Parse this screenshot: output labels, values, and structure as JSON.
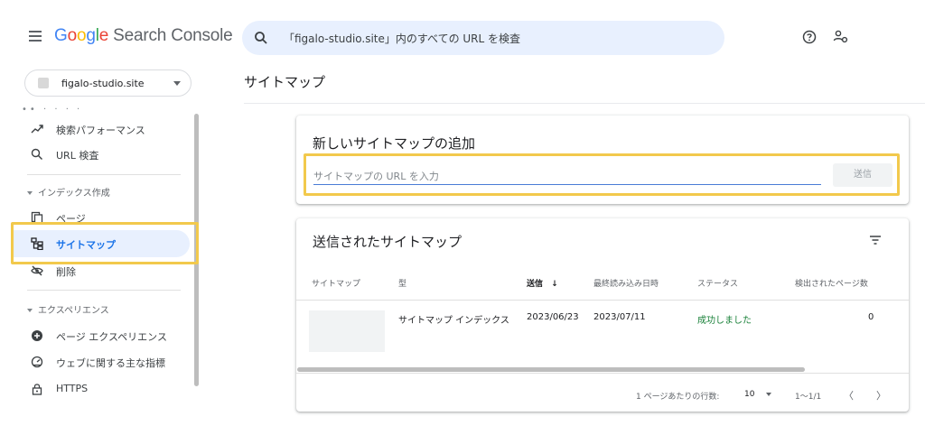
{
  "header": {
    "logo_parts": [
      "G",
      "o",
      "o",
      "g",
      "l",
      "e"
    ],
    "product": "Search Console",
    "search_placeholder": "「figalo-studio.site」内のすべての URL を検査",
    "icons": [
      "menu-icon",
      "search-icon",
      "help-icon",
      "users-settings-icon"
    ]
  },
  "sidebar": {
    "property_name": "figalo-studio.site",
    "peek_text": "•• · · · ·",
    "items_top": [
      {
        "label": "検索パフォーマンス",
        "icon": "trending-up-icon"
      },
      {
        "label": "URL 検査",
        "icon": "search-icon"
      }
    ],
    "section_index": "インデックス作成",
    "items_index": [
      {
        "label": "ページ",
        "icon": "pages-icon"
      },
      {
        "label": "サイトマップ",
        "icon": "sitemap-icon",
        "active": true
      },
      {
        "label": "削除",
        "icon": "removal-icon"
      }
    ],
    "section_experience": "エクスペリエンス",
    "items_experience": [
      {
        "label": "ページ エクスペリエンス",
        "icon": "plus-circle-icon"
      },
      {
        "label": "ウェブに関する主な指標",
        "icon": "gauge-icon"
      },
      {
        "label": "HTTPS",
        "icon": "lock-icon"
      }
    ]
  },
  "main": {
    "page_title": "サイトマップ",
    "add_card": {
      "title": "新しいサイトマップの追加",
      "input_placeholder": "サイトマップの URL を入力",
      "input_value": "",
      "send_label": "送信"
    },
    "submitted_card": {
      "title": "送信されたサイトマップ",
      "columns": [
        "サイトマップ",
        "型",
        "送信",
        "最終読み込み日時",
        "ステータス",
        "検出されたページ数"
      ],
      "sort_arrow": "↓",
      "rows": [
        {
          "type": "サイトマップ インデックス",
          "submitted": "2023/06/23",
          "last_read": "2023/07/11",
          "status": "成功しました",
          "pages": "0"
        }
      ],
      "pager": {
        "rows_label": "1 ページあたりの行数:",
        "rows_value": "10",
        "range": "1〜1/1",
        "prev": "〈",
        "next": "〉"
      }
    }
  },
  "colors": {
    "accent": "#1a73e8",
    "highlight": "#f2c94c",
    "success": "#188038",
    "search_bg": "#e8f0fe"
  }
}
